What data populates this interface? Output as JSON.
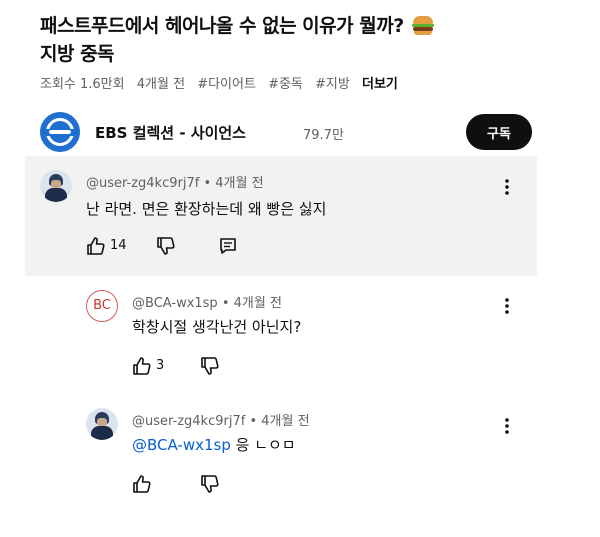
{
  "video": {
    "title": "패스트푸드에서 헤어나올 수 없는 이유가 뭘까? ",
    "title_line2": "지방 중독",
    "views": "조회수 1.6만회",
    "age": "4개월 전",
    "tags": [
      "#다이어트",
      "#중독",
      "#지방"
    ],
    "more_label": "더보기"
  },
  "channel": {
    "name": "EBS 컬렉션 - 사이언스",
    "subscribers": "79.7만",
    "subscribe_label": "구독"
  },
  "comments": [
    {
      "author": "@user-zg4kc9rj7f",
      "age": "• 4개월 전",
      "text": "난 라면. 면은 환장하는데 왜 빵은 싫지",
      "likes": "14",
      "highlighted": true
    },
    {
      "author": "@BCA-wx1sp",
      "age": "• 4개월 전",
      "avatar_initials": "BC",
      "text": "학창시절 생각난건 아닌지?",
      "likes": "3"
    },
    {
      "author": "@user-zg4kc9rj7f",
      "age": "• 4개월 전",
      "mention": "@BCA-wx1sp",
      "text": " 응 ㄴㅇㅁ",
      "likes": ""
    }
  ],
  "colors": {
    "highlight_bg": "#f2f2f2",
    "mention": "#065fd4",
    "subscribe_bg": "#0f0f0f",
    "channel_logo": "#1f6fd0"
  },
  "icons": [
    "burger-icon",
    "thumbs-up-icon",
    "thumbs-down-icon",
    "reply-icon",
    "more-vert-icon"
  ]
}
